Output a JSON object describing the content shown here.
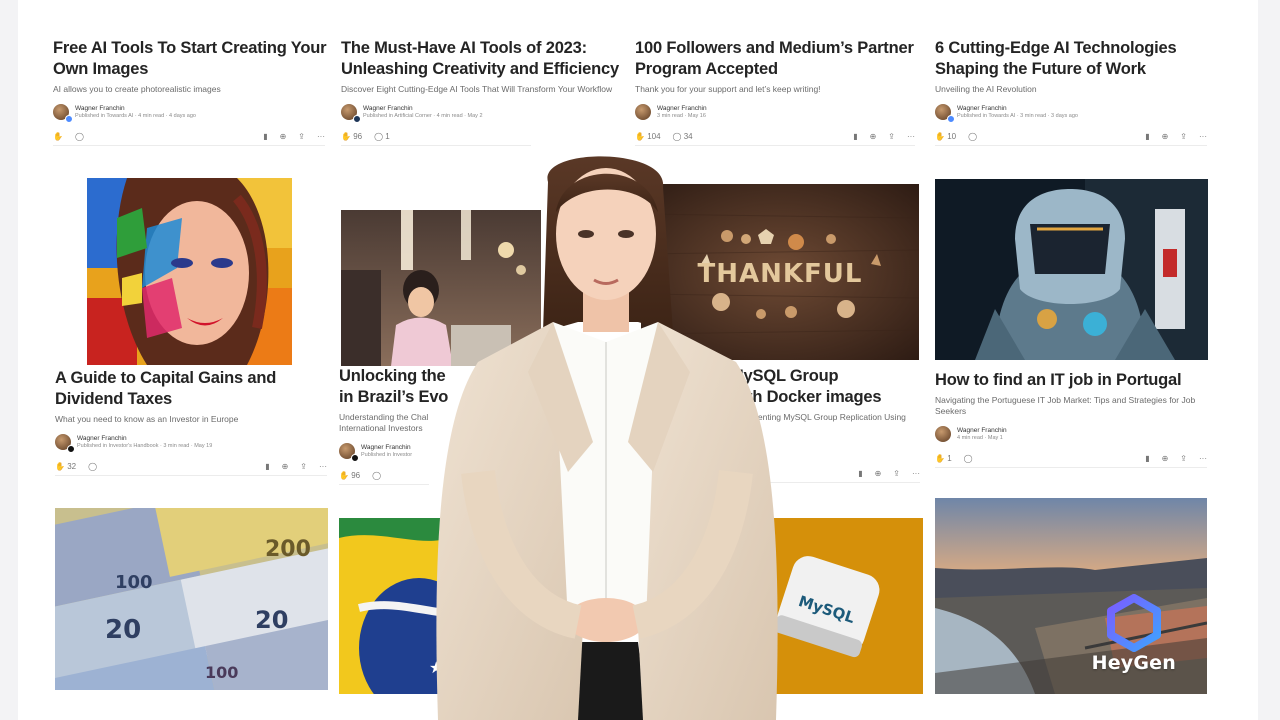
{
  "articles": [
    {
      "title": "Free AI Tools To Start Creating Your Own Images",
      "subtitle": "AI allows you to create photorealistic images",
      "author": "Wagner Franchin",
      "meta": "Published in Towards AI · 4 min read · 4 days ago",
      "claps": "",
      "responses": ""
    },
    {
      "title": "The Must-Have AI Tools of 2023: Unleashing Creativity and Efficiency",
      "subtitle": "Discover Eight Cutting-Edge AI Tools That Will Transform Your Workflow",
      "author": "Wagner Franchin",
      "meta": "Published in Artificial Corner · 4 min read · May 2",
      "claps": "96",
      "responses": "1"
    },
    {
      "title": "100 Followers and Medium’s Partner Program Accepted",
      "subtitle": "Thank you for your support and let’s keep writing!",
      "author": "Wagner Franchin",
      "meta": "3 min read · May 16",
      "claps": "104",
      "responses": "34"
    },
    {
      "title": "6 Cutting-Edge AI Technologies Shaping the Future of Work",
      "subtitle": "Unveiling the AI Revolution",
      "author": "Wagner Franchin",
      "meta": "Published in Towards AI · 3 min read · 3 days ago",
      "claps": "10",
      "responses": ""
    },
    {
      "title": "A Guide to Capital Gains and Dividend Taxes",
      "subtitle": "What you need to know as an Investor in Europe",
      "author": "Wagner Franchin",
      "meta": "Published in Investor's Handbook · 3 min read · May 19",
      "claps": "32",
      "responses": ""
    },
    {
      "title": "Unlocking the",
      "title2": "in Brazil’s Evo",
      "subtitle": "Understanding the Chal",
      "subtitle2": "International Investors",
      "author": "Wagner Franchin",
      "meta": "Published in Investor",
      "claps": "96",
      "responses": ""
    },
    {
      "title": "MySQL Group",
      "title2": "with Docker images",
      "subtitle": "Implementing MySQL Group Replication Using",
      "author": "",
      "meta": "",
      "claps": "",
      "responses": ""
    },
    {
      "title": "How to find an IT job in Portugal",
      "subtitle": "Navigating the Portuguese IT Job Market: Tips and Strategies for Job Seekers",
      "author": "Wagner Franchin",
      "meta": "4 min read · May 1",
      "claps": "1",
      "responses": ""
    }
  ],
  "images": {
    "thankful_text": "THANKFUL",
    "mysql_text": "MySQL",
    "euro_notes": [
      "200",
      "100",
      "20",
      "20",
      "100"
    ]
  },
  "watermark": {
    "brand": "HeyGen"
  },
  "colors": {
    "accent": "#1a8917",
    "brand_blue": "#4d8bff",
    "mysql_orange": "#d5900a"
  },
  "icons": [
    "clap-icon",
    "comment-icon",
    "bookmark-icon",
    "play-icon",
    "share-icon",
    "more-icon",
    "heygen-logo-icon"
  ]
}
